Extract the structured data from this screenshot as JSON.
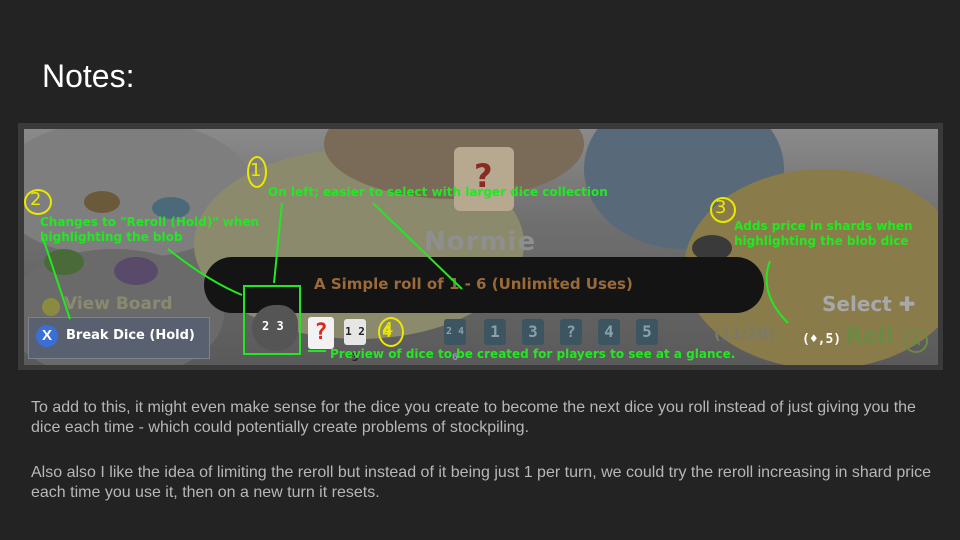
{
  "slide": {
    "title": "Notes:",
    "paragraphs": [
      "To add to this, it might even make sense for the dice you create to become the next dice you roll instead of just giving you the dice each time - which could potentially create problems of stockpiling.",
      "Also also I like the idea of limiting the reroll but instead of it being just 1 per turn, we could try the reroll increasing in shard price each time you use it, then on a new turn it resets."
    ]
  },
  "game": {
    "dice_name": "Normie",
    "dice_description": "A Simple roll of 1 - 6 (Unlimited Uses)",
    "view_board": "View Board",
    "break_dice": "Break Dice (Hold)",
    "count": "(11/20)",
    "select": "Select",
    "roll": "Roll",
    "price": "(♦,5)",
    "dice_faces": [
      "?",
      "1 2 3",
      "4",
      "2 4 6",
      "1",
      "3",
      "?",
      "4",
      "5"
    ],
    "colors": {
      "annotation": "#22e822",
      "marker": "#e8e800",
      "roll": "#6c8a46"
    }
  },
  "annotations": {
    "n1": "1",
    "n2": "2",
    "n3": "3",
    "n4": "4",
    "on_left": "On left; easier to select with larger dice collection",
    "changes_1": "Changes to \"Reroll (Hold)\" when",
    "changes_2": "highlighting the blob",
    "adds_1": "Adds price in shards when",
    "adds_2": "highlighting the blob dice",
    "preview": "Preview of dice to be created for players to see at a glance."
  }
}
